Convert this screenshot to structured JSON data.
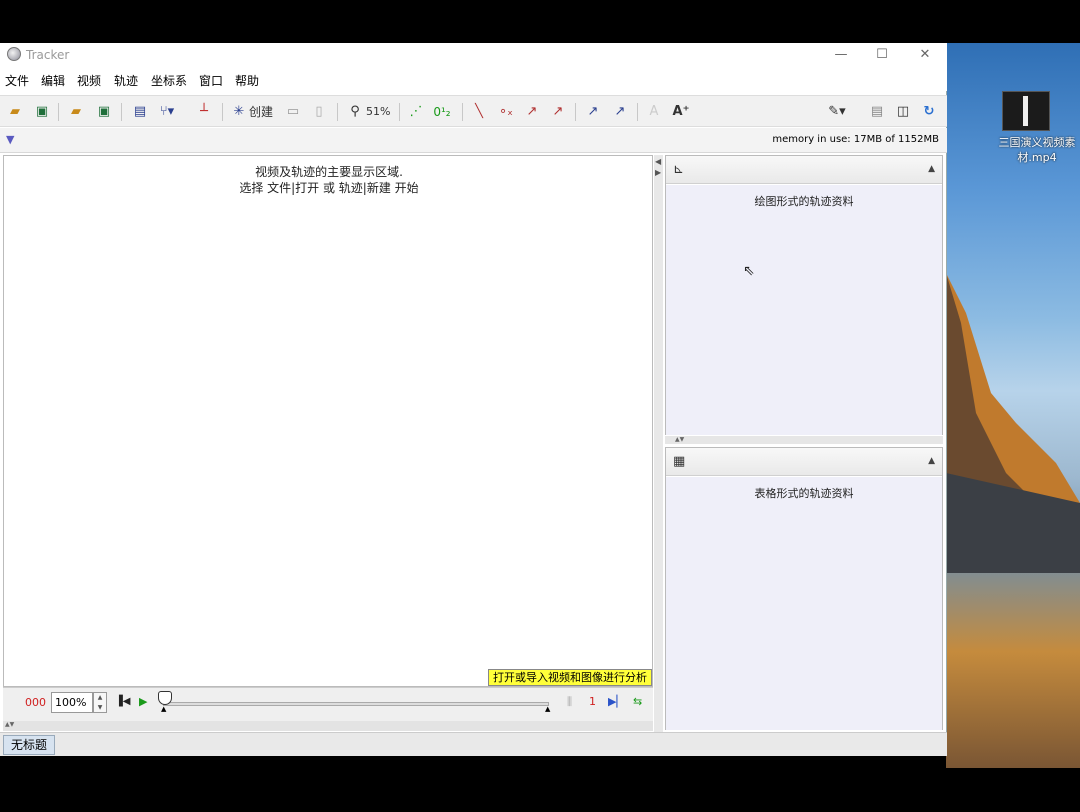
{
  "window": {
    "title": "Tracker",
    "controls": {
      "minimize": "—",
      "maximize": "☐",
      "close": "✕"
    }
  },
  "menu": [
    "文件",
    "编辑",
    "视频",
    "轨迹",
    "坐标系",
    "窗口",
    "帮助"
  ],
  "toolbar": {
    "create_label": "创建",
    "zoom_label": "51%"
  },
  "info": {
    "memory": "memory in use: 17MB of 1152MB"
  },
  "main_view": {
    "hint_line1": "视频及轨迹的主要显示区域.",
    "hint_line2": "选择 文件|打开 或 轨迹|新建 开始",
    "open_tip": "打开或导入视频和图像进行分析"
  },
  "player": {
    "frame": "000",
    "zoom": "100%",
    "step": "1"
  },
  "plot_panel": {
    "text": "绘图形式的轨迹资料"
  },
  "table_panel": {
    "text": "表格形式的轨迹资料"
  },
  "status": {
    "tab": "无标题"
  },
  "desktop": {
    "icon_label": "三国演义视频素材.mp4"
  },
  "icons": [
    "open-folder-icon",
    "save-icon",
    "open-file-icon",
    "export-icon",
    "clip-settings-icon",
    "calibration-icon",
    "axes-icon",
    "create-track-icon",
    "ruler-icon",
    "magnifier-icon",
    "trail-icon",
    "label-icon",
    "path-icon",
    "position-icon",
    "velocity-icon",
    "acceleration-icon",
    "font-icon",
    "pencil-icon",
    "refresh-icon",
    "plot-icon",
    "table-icon"
  ],
  "colors": {
    "accent_green": "#1a9a1a",
    "accent_red": "#d02020",
    "tip_yellow": "#ffff3a",
    "panel_lavender": "#efeff9"
  }
}
